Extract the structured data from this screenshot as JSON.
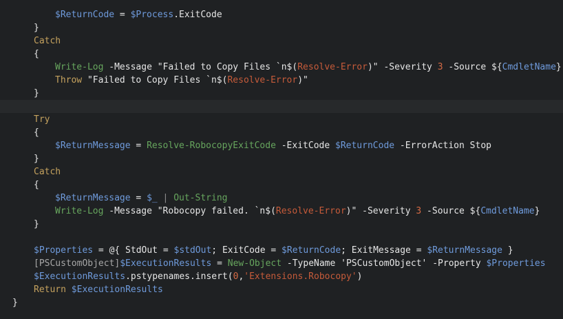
{
  "editor": {
    "language": "PowerShell",
    "colors": {
      "background": "#1f2123",
      "current_line": "#27292b",
      "plain": "#e6e6e6",
      "variable": "#6f9bdc",
      "keyword": "#c5a25e",
      "cmdlet": "#67a65e",
      "subexpression": "#c65b3a",
      "number": "#d66b45"
    },
    "lines": [
      {
        "indent": 2,
        "tokens": [
          [
            "var",
            "$ReturnCode"
          ],
          [
            "plain",
            " = "
          ],
          [
            "var",
            "$Process"
          ],
          [
            "plain",
            ".ExitCode"
          ]
        ]
      },
      {
        "indent": 1,
        "tokens": [
          [
            "brace",
            "}"
          ]
        ]
      },
      {
        "indent": 1,
        "tokens": [
          [
            "kw",
            "Catch"
          ]
        ]
      },
      {
        "indent": 1,
        "tokens": [
          [
            "brace",
            "{"
          ]
        ]
      },
      {
        "indent": 2,
        "tokens": [
          [
            "cmd",
            "Write-Log"
          ],
          [
            "plain",
            " -Message \"Failed to Copy Files `n$("
          ],
          [
            "sub",
            "Resolve-Error"
          ],
          [
            "plain",
            ")\" -Severity "
          ],
          [
            "num",
            "3"
          ],
          [
            "plain",
            " -Source ${"
          ],
          [
            "var",
            "CmdletName"
          ],
          [
            "plain",
            "}"
          ]
        ]
      },
      {
        "indent": 2,
        "tokens": [
          [
            "kw",
            "Throw"
          ],
          [
            "plain",
            " \"Failed to Copy Files `n$("
          ],
          [
            "sub",
            "Resolve-Error"
          ],
          [
            "plain",
            ")\""
          ]
        ]
      },
      {
        "indent": 1,
        "tokens": [
          [
            "brace",
            "}"
          ]
        ]
      },
      {
        "indent": 0,
        "tokens": [],
        "current": true
      },
      {
        "indent": 1,
        "tokens": [
          [
            "kw",
            "Try"
          ]
        ]
      },
      {
        "indent": 1,
        "tokens": [
          [
            "brace",
            "{"
          ]
        ]
      },
      {
        "indent": 2,
        "tokens": [
          [
            "var",
            "$ReturnMessage"
          ],
          [
            "plain",
            " = "
          ],
          [
            "cmd",
            "Resolve-RobocopyExitCode"
          ],
          [
            "plain",
            " -ExitCode "
          ],
          [
            "var",
            "$ReturnCode"
          ],
          [
            "plain",
            " -ErrorAction Stop"
          ]
        ]
      },
      {
        "indent": 1,
        "tokens": [
          [
            "brace",
            "}"
          ]
        ]
      },
      {
        "indent": 1,
        "tokens": [
          [
            "kw",
            "Catch"
          ]
        ]
      },
      {
        "indent": 1,
        "tokens": [
          [
            "brace",
            "{"
          ]
        ]
      },
      {
        "indent": 2,
        "tokens": [
          [
            "var",
            "$ReturnMessage"
          ],
          [
            "plain",
            " = "
          ],
          [
            "var",
            "$_"
          ],
          [
            "plain",
            " "
          ],
          [
            "op",
            "|"
          ],
          [
            "plain",
            " "
          ],
          [
            "cmd",
            "Out-String"
          ]
        ]
      },
      {
        "indent": 2,
        "tokens": [
          [
            "cmd",
            "Write-Log"
          ],
          [
            "plain",
            " -Message \"Robocopy failed. `n$("
          ],
          [
            "sub",
            "Resolve-Error"
          ],
          [
            "plain",
            ")\" -Severity "
          ],
          [
            "num",
            "3"
          ],
          [
            "plain",
            " -Source ${"
          ],
          [
            "var",
            "CmdletName"
          ],
          [
            "plain",
            "}"
          ]
        ]
      },
      {
        "indent": 1,
        "tokens": [
          [
            "brace",
            "}"
          ]
        ]
      },
      {
        "indent": 0,
        "tokens": []
      },
      {
        "indent": 1,
        "tokens": [
          [
            "var",
            "$Properties"
          ],
          [
            "plain",
            " = @{ StdOut = "
          ],
          [
            "var",
            "$stdOut"
          ],
          [
            "plain",
            "; ExitCode = "
          ],
          [
            "var",
            "$ReturnCode"
          ],
          [
            "plain",
            "; ExitMessage = "
          ],
          [
            "var",
            "$ReturnMessage"
          ],
          [
            "plain",
            " }"
          ]
        ]
      },
      {
        "indent": 1,
        "tokens": [
          [
            "type",
            "[PSCustomObject]"
          ],
          [
            "var",
            "$ExecutionResults"
          ],
          [
            "plain",
            " = "
          ],
          [
            "cmd",
            "New-Object"
          ],
          [
            "plain",
            " -TypeName "
          ],
          [
            "str",
            "'PSCustomObject'"
          ],
          [
            "plain",
            " -Property "
          ],
          [
            "var",
            "$Properties"
          ]
        ]
      },
      {
        "indent": 1,
        "tokens": [
          [
            "var",
            "$ExecutionResults"
          ],
          [
            "plain",
            ".pstypenames.insert("
          ],
          [
            "num",
            "0"
          ],
          [
            "plain",
            ","
          ],
          [
            "sub",
            "'Extensions.Robocopy'"
          ],
          [
            "plain",
            ")"
          ]
        ]
      },
      {
        "indent": 1,
        "tokens": [
          [
            "kw",
            "Return"
          ],
          [
            "plain",
            " "
          ],
          [
            "var",
            "$ExecutionResults"
          ]
        ]
      },
      {
        "indent": 0,
        "tokens": [
          [
            "brace",
            "}"
          ]
        ]
      }
    ]
  }
}
